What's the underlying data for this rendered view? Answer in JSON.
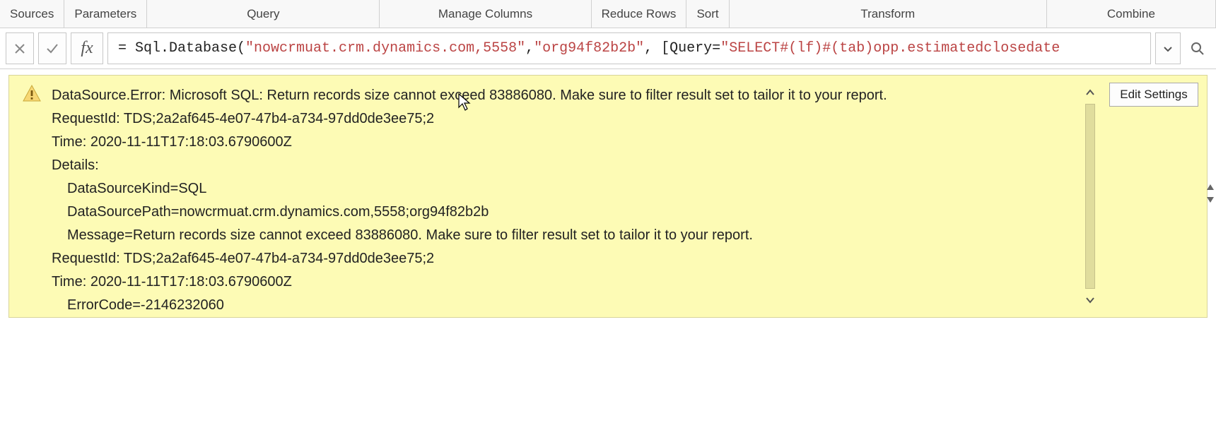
{
  "ribbon": {
    "sources": "Sources",
    "parameters": "Parameters",
    "query": "Query",
    "manage_columns": "Manage Columns",
    "reduce_rows": "Reduce Rows",
    "sort": "Sort",
    "transform": "Transform",
    "combine": "Combine"
  },
  "formula_bar": {
    "fx": "fx",
    "prefix": "= Sql.Database(",
    "arg1": "\"nowcrmuat.crm.dynamics.com,5558\"",
    "sep1": ", ",
    "arg2": "\"org94f82b2b\"",
    "sep2": ", [Query=",
    "arg3": "\"SELECT#(lf)#(tab)opp.estimatedclosedate"
  },
  "error": {
    "line1": "DataSource.Error: Microsoft SQL: Return records size cannot exceed 83886080. Make sure to filter result set to tailor it to your report.",
    "line2": "RequestId: TDS;2a2af645-4e07-47b4-a734-97dd0de3ee75;2",
    "line3": "Time: 2020-11-11T17:18:03.6790600Z",
    "line4": "Details:",
    "line5": "DataSourceKind=SQL",
    "line6": "DataSourcePath=nowcrmuat.crm.dynamics.com,5558;org94f82b2b",
    "line7": "Message=Return records size cannot exceed 83886080. Make sure to filter result set to tailor it to your report.",
    "line8": "RequestId: TDS;2a2af645-4e07-47b4-a734-97dd0de3ee75;2",
    "line9": "Time: 2020-11-11T17:18:03.6790600Z",
    "line10": "ErrorCode=-2146232060",
    "edit_settings": "Edit Settings"
  }
}
